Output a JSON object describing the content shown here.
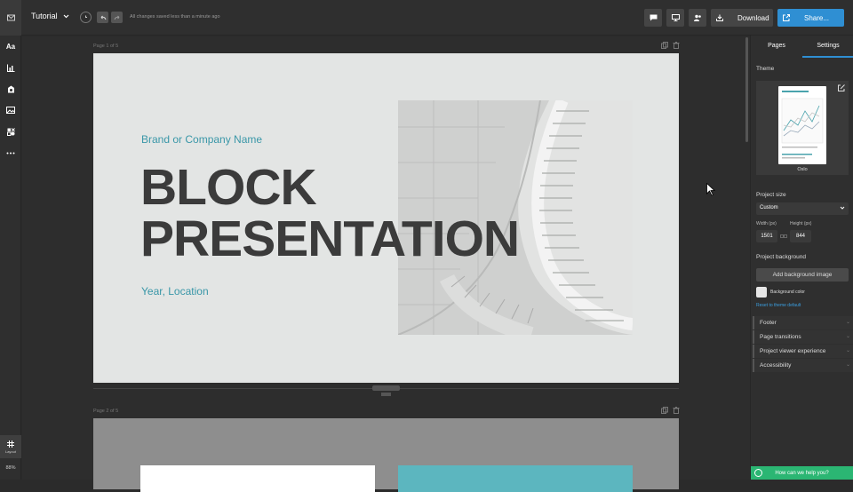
{
  "topbar": {
    "doc_title": "Tutorial",
    "saved_status": "All changes saved less than a minute ago",
    "download_label": "Download",
    "share_label": "Share..."
  },
  "leftbar": {
    "items": [
      {
        "icon": "text-icon",
        "label": "Aa"
      },
      {
        "icon": "chart-icon"
      },
      {
        "icon": "media-icon"
      },
      {
        "icon": "image-icon"
      },
      {
        "icon": "shapes-icon"
      },
      {
        "icon": "more-icon"
      }
    ],
    "layout_label": "Layout",
    "zoom": "88%"
  },
  "canvas": {
    "page1_label": "Page 1 of 5",
    "page2_label": "Page 2 of 5",
    "slide1": {
      "brand": "Brand or Company Name",
      "headline_line1": "BLOCK",
      "headline_line2": "PRESENTATION",
      "subtitle": "Year, Location"
    }
  },
  "right_panel": {
    "tabs": [
      "Pages",
      "Settings"
    ],
    "active_tab": "Settings",
    "theme_heading": "Theme",
    "theme_name": "Oslo",
    "project_size_heading": "Project size",
    "size_select": "Custom",
    "width_label": "Width (px)",
    "height_label": "Height (px)",
    "width_value": "1501",
    "height_value": "844",
    "bg_heading": "Project background",
    "add_bg_label": "Add background image",
    "bg_color_label": "Background color",
    "reset_link": "Reset to theme default",
    "accordions": [
      "Footer",
      "Page transitions",
      "Project viewer experience",
      "Accessibility"
    ]
  },
  "help": {
    "label": "How can we help you?"
  },
  "colors": {
    "accent": "#2f8fd3",
    "brand_teal": "#3a97a8",
    "help_green": "#2bb673"
  }
}
